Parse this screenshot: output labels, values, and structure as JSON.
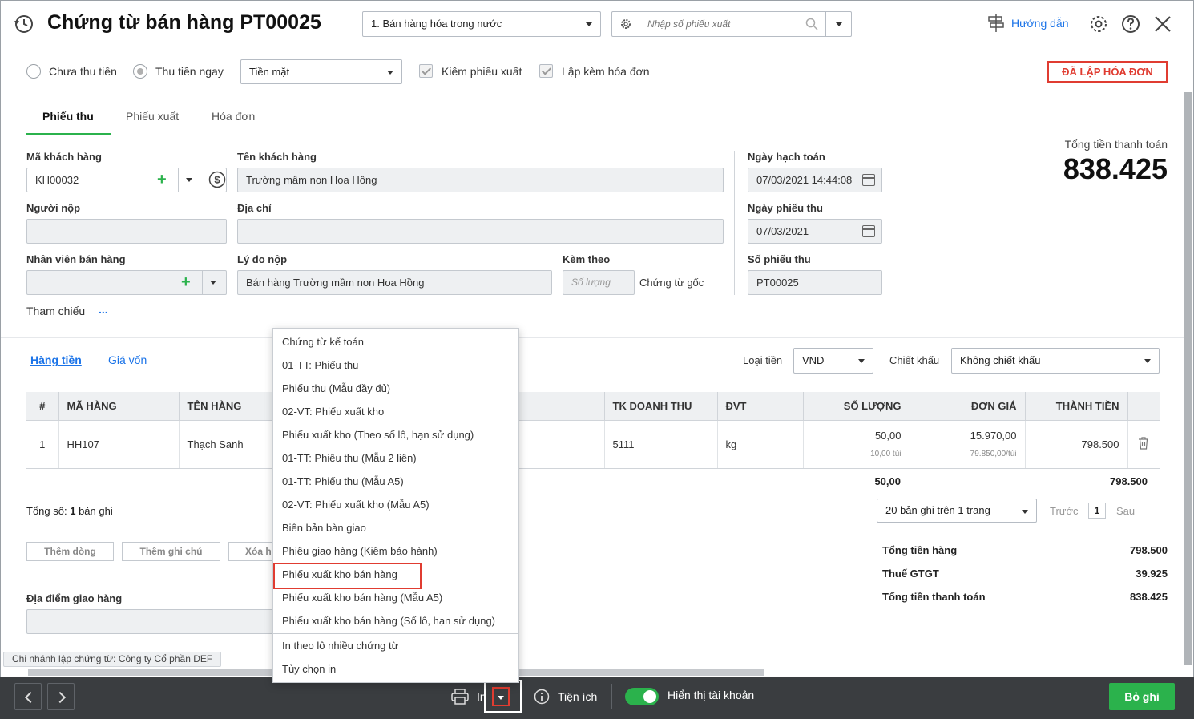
{
  "header": {
    "title": "Chứng từ bán hàng PT00025",
    "sale_type": "1. Bán hàng hóa trong nước",
    "search_placeholder": "Nhập số phiếu xuất",
    "help_label": "Hướng dẫn"
  },
  "options": {
    "radio_unpaid": "Chưa thu tiền",
    "radio_paid": "Thu tiền ngay",
    "payment_method": "Tiền mặt",
    "check_delivery": "Kiêm phiếu xuất",
    "check_invoice": "Lập kèm hóa đơn",
    "status_badge": "ĐÃ LẬP HÓA ĐƠN"
  },
  "tabs": [
    {
      "label": "Phiếu thu"
    },
    {
      "label": "Phiếu xuất"
    },
    {
      "label": "Hóa đơn"
    }
  ],
  "form": {
    "customer_code_label": "Mã khách hàng",
    "customer_code": "KH00032",
    "customer_name_label": "Tên khách hàng",
    "customer_name": "Trường mầm non Hoa Hồng",
    "payer_label": "Người nộp",
    "payer": "",
    "address_label": "Địa chỉ",
    "address": "",
    "salesperson_label": "Nhân viên bán hàng",
    "salesperson": "",
    "reason_label": "Lý do nộp",
    "reason": "Bán hàng Trường mầm non Hoa Hồng",
    "attach_label": "Kèm theo",
    "attach_placeholder": "Số lượng",
    "attach_suffix": "Chứng từ gốc",
    "reference_label": "Tham chiếu",
    "reference_more": "...",
    "posting_date_label": "Ngày hạch toán",
    "posting_date": "07/03/2021 14:44:08",
    "receipt_date_label": "Ngày phiếu thu",
    "receipt_date": "07/03/2021",
    "receipt_no_label": "Số phiếu thu",
    "receipt_no": "PT00025",
    "total_label": "Tổng tiền thanh toán",
    "total_value": "838.425"
  },
  "detail": {
    "subtab_amount": "Hàng tiền",
    "subtab_cost": "Giá vốn",
    "currency_label": "Loại tiền",
    "currency": "VND",
    "discount_label": "Chiết khấu",
    "discount": "Không chiết khấu",
    "columns": [
      "#",
      "MÃ HÀNG",
      "TÊN HÀNG",
      "TK DOANH THU",
      "ĐVT",
      "SỐ LƯỢNG",
      "ĐƠN GIÁ",
      "THÀNH TIỀN"
    ],
    "rows": [
      {
        "no": "1",
        "code": "HH107",
        "name": "Thạch Sanh",
        "account": "5111",
        "unit": "kg",
        "qty": "50,00",
        "qty_sub": "10,00 túi",
        "price": "15.970,00",
        "price_sub": "79.850,00/túi",
        "amount": "798.500"
      }
    ],
    "footer_qty": "50,00",
    "footer_amount": "798.500",
    "record_count_prefix": "Tổng số:",
    "record_count": "1",
    "record_count_suffix": "bản ghi",
    "page_size": "20 bản ghi trên 1 trang",
    "prev": "Trước",
    "page": "1",
    "next": "Sau",
    "add_row": "Thêm dòng",
    "add_note": "Thêm ghi chú",
    "delete_row": "Xóa h",
    "delivery_place_label": "Địa điểm giao hàng",
    "delivery_place": ""
  },
  "summary": {
    "subtotal_label": "Tổng tiền hàng",
    "subtotal": "798.500",
    "vat_label": "Thuế GTGT",
    "vat": "39.925",
    "grand_label": "Tổng tiền thanh toán",
    "grand": "838.425"
  },
  "print_menu": {
    "items": [
      "Chứng từ kế toán",
      "01-TT: Phiếu thu",
      "Phiếu thu (Mẫu đầy đủ)",
      "02-VT: Phiếu xuất kho",
      "Phiếu xuất kho (Theo số lô, hạn sử dụng)",
      "01-TT: Phiếu thu (Mẫu 2 liên)",
      "01-TT: Phiếu thu (Mẫu A5)",
      "02-VT: Phiếu xuất kho (Mẫu A5)",
      "Biên bản bàn giao",
      "Phiếu giao hàng (Kiêm bảo hành)",
      "Phiếu xuất kho bán hàng",
      "Phiếu xuất kho bán hàng (Mẫu A5)",
      "Phiếu xuất kho bán hàng (Số lô, hạn sử dụng)"
    ],
    "extra_items": [
      "In theo lô nhiều chứng từ",
      "Tùy chọn in"
    ],
    "highlighted": "Phiếu xuất kho bán hàng"
  },
  "footer": {
    "branch": "Chi nhánh lập chứng từ: Công ty Cổ phần DEF",
    "print_label": "In",
    "utility_label": "Tiện ích",
    "show_account_label": "Hiển thị tài khoản",
    "show_account_on": true,
    "save_label": "Bỏ ghi"
  },
  "colors": {
    "accent": "#2bb24c",
    "danger": "#e03c31",
    "link": "#1a73e8",
    "bottom_bar": "#3a3d40"
  }
}
